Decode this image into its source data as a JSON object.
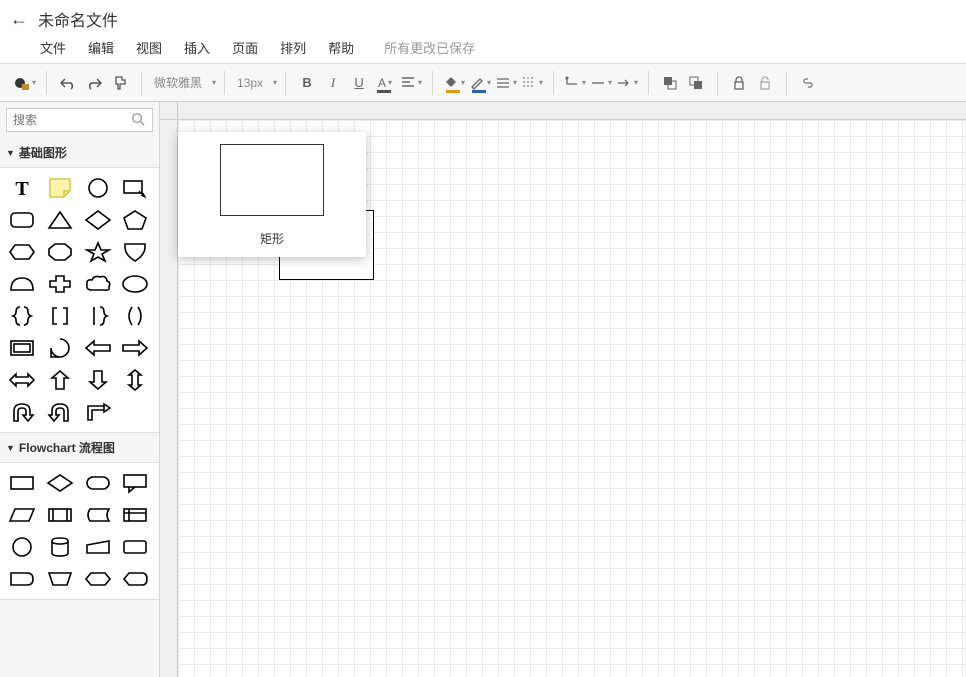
{
  "header": {
    "doc_title": "未命名文件",
    "menus": [
      "文件",
      "编辑",
      "视图",
      "插入",
      "页面",
      "排列",
      "帮助"
    ],
    "save_status": "所有更改已保存"
  },
  "toolbar": {
    "font_family": "微软雅黑",
    "font_size": "13px",
    "fill_accent": "#e59818",
    "stroke_accent": "#2f5fb5"
  },
  "sidebar": {
    "search_placeholder": "搜索",
    "categories": [
      {
        "label": "基础图形",
        "expanded": true
      },
      {
        "label": "Flowchart 流程图",
        "expanded": true
      }
    ]
  },
  "tooltip": {
    "label": "矩形"
  }
}
